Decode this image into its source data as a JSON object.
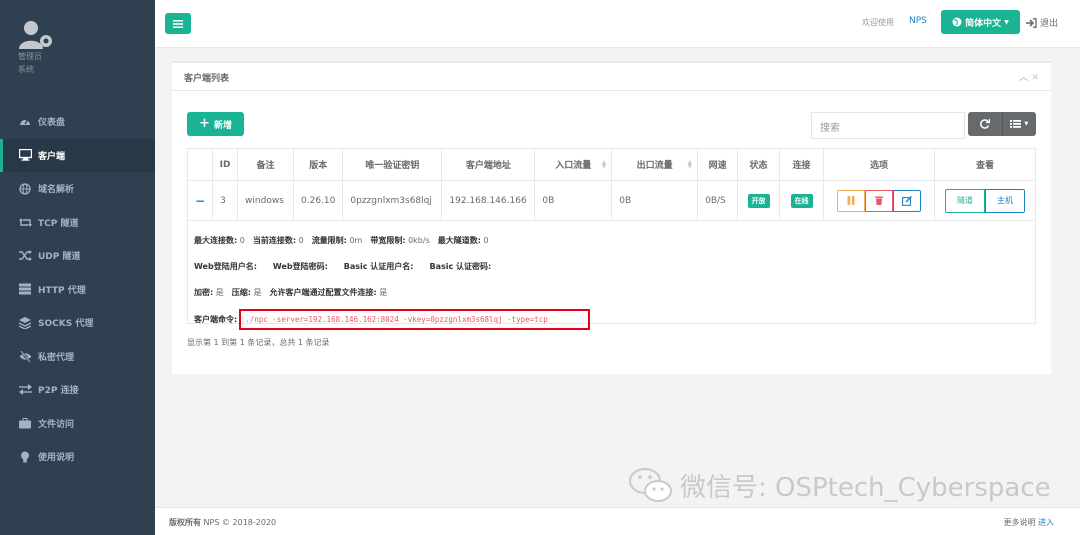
{
  "sidebar": {
    "profile_name": "管理员",
    "profile_role": "系统",
    "items": [
      {
        "label": "仪表盘",
        "icon": "dashboard-icon"
      },
      {
        "label": "客户端",
        "icon": "desktop-icon",
        "active": true
      },
      {
        "label": "域名解析",
        "icon": "globe-icon"
      },
      {
        "label": "TCP 隧道",
        "icon": "retweet-icon"
      },
      {
        "label": "UDP 隧道",
        "icon": "random-icon"
      },
      {
        "label": "HTTP 代理",
        "icon": "server-icon"
      },
      {
        "label": "SOCKS 代理",
        "icon": "layers-icon"
      },
      {
        "label": "私密代理",
        "icon": "eye-slash-icon"
      },
      {
        "label": "P2P 连接",
        "icon": "exchange-icon"
      },
      {
        "label": "文件访问",
        "icon": "briefcase-icon"
      },
      {
        "label": "使用说明",
        "icon": "lightbulb-icon"
      }
    ]
  },
  "topbar": {
    "welcome": "欢迎使用",
    "brand": "NPS",
    "language": "简体中文",
    "logout": "退出"
  },
  "panel": {
    "title": "客户端列表",
    "add_label": "新增",
    "search_placeholder": "搜索"
  },
  "table": {
    "headers": [
      "ID",
      "备注",
      "版本",
      "唯一验证密钥",
      "客户端地址",
      "入口流量",
      "出口流量",
      "网速",
      "状态",
      "连接",
      "选项",
      "查看"
    ],
    "row": {
      "expand": "−",
      "id": "3",
      "remark": "windows",
      "version": "0.26.10",
      "vkey": "0pzzgnlxm3s68lqj",
      "address": "192.168.146.166",
      "in_flow": "0B",
      "out_flow": "0B",
      "speed": "0B/S",
      "status": "开放",
      "connect": "在线",
      "view_tunnel": "隧道",
      "view_host": "主机"
    }
  },
  "detail": {
    "max_conn_label": "最大连接数:",
    "max_conn": "0",
    "cur_conn_label": "当前连接数:",
    "cur_conn": "0",
    "flow_limit_label": "流量限制:",
    "flow_limit": "0m",
    "rate_limit_label": "带宽限制:",
    "rate_limit": "0kb/s",
    "max_tunnel_label": "最大隧道数:",
    "max_tunnel": "0",
    "web_user_label": "Web登陆用户名:",
    "web_pass_label": "Web登陆密码:",
    "basic_user_label": "Basic 认证用户名:",
    "basic_pass_label": "Basic 认证密码:",
    "crypt_label": "加密:",
    "crypt": "是",
    "compress_label": "压缩:",
    "compress": "是",
    "config_conn_label": "允许客户端通过配置文件连接:",
    "config_conn": "是",
    "cmd_label": "客户端命令:",
    "cmd": "./npc -server=192.168.146.162:8024 -vkey=0pzzgnlxm3s68lqj -type=tcp"
  },
  "pager": "显示第 1 到第 1 条记录，总共 1 条记录",
  "footer": {
    "copyright_bold": "版权所有",
    "copyright": "NPS © 2018-2020",
    "more": "更多说明",
    "enter": "进入"
  },
  "watermark": "微信号: OSPtech_Cyberspace",
  "colors": {
    "accent": "#1ab394",
    "sidebar": "#2f4050",
    "link": "#1c84c6",
    "danger": "#ed5565",
    "warning": "#f8ac59"
  }
}
